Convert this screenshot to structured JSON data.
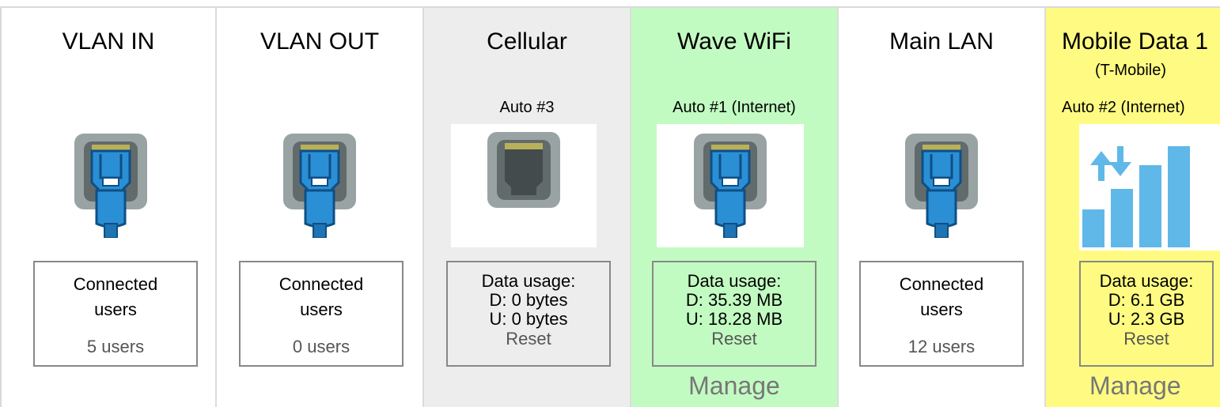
{
  "columns": [
    {
      "name": "VLAN IN",
      "stat_line1": "Connected",
      "stat_line2": "users",
      "stat_value": "5 users",
      "icon": "ethernet-connected-icon"
    },
    {
      "name": "VLAN OUT",
      "stat_line1": "Connected",
      "stat_line2": "users",
      "stat_value": "0 users",
      "icon": "ethernet-connected-icon"
    },
    {
      "name": "Cellular",
      "status": "Auto #3",
      "usage_title": "Data usage:",
      "down": "D: 0 bytes",
      "up": "U: 0 bytes",
      "reset": "Reset",
      "icon": "ethernet-port-empty-icon"
    },
    {
      "name": "Wave WiFi",
      "status": "Auto #1 (Internet)",
      "usage_title": "Data usage:",
      "down": "D: 35.39 MB",
      "up": "U: 18.28 MB",
      "reset": "Reset",
      "manage": "Manage",
      "icon": "ethernet-connected-icon"
    },
    {
      "name": "Main LAN",
      "stat_line1": "Connected",
      "stat_line2": "users",
      "stat_value": "12 users",
      "icon": "ethernet-connected-icon"
    },
    {
      "name": "Mobile Data 1",
      "carrier": "(T-Mobile)",
      "status": "Auto #2 (Internet)",
      "usage_title": "Data usage:",
      "down": "D: 6.1 GB",
      "up": "U: 2.3 GB",
      "reset": "Reset",
      "manage": "Manage",
      "icon": "cellular-signal-icon"
    }
  ],
  "colors": {
    "cellular_bg": "#ededed",
    "wave_bg": "#c2fbc2",
    "mobile_bg": "#fffb82",
    "plug_blue": "#2b8fd6"
  }
}
